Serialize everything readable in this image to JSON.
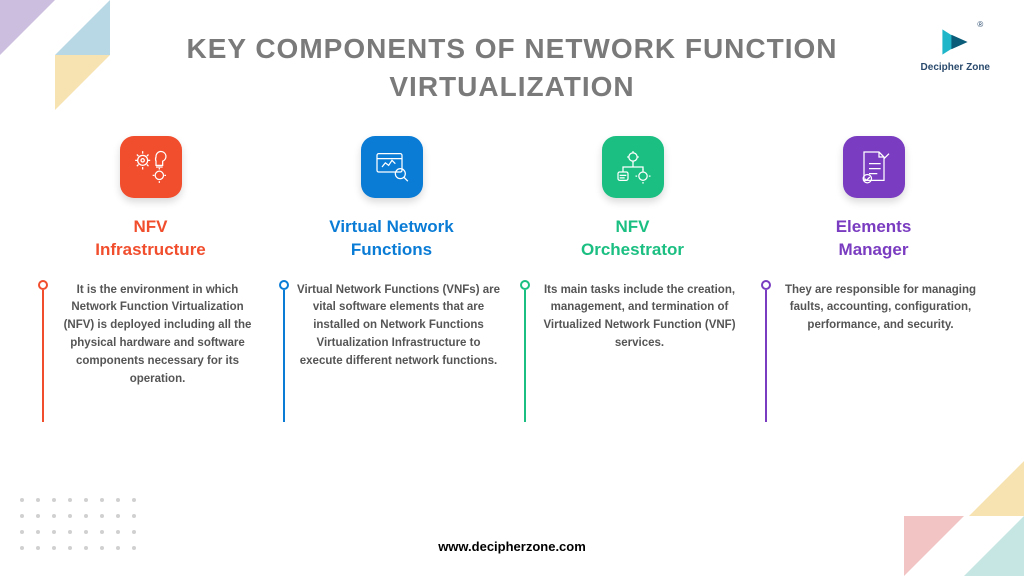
{
  "title_line1": "KEY COMPONENTS OF NETWORK FUNCTION",
  "title_line2": "VIRTUALIZATION",
  "brand": {
    "name": "Decipher Zone",
    "register": "®"
  },
  "footer": "www.decipherzone.com",
  "colors": {
    "c1": "#f14e2e",
    "c2": "#0a7cd6",
    "c3": "#1bbf82",
    "c4": "#7a3cc0"
  },
  "cards": [
    {
      "title_l1": "NFV",
      "title_l2": "Infrastructure",
      "icon": "gears-bulb-icon",
      "desc": "It is the environment in which Network Function Virtualization (NFV) is deployed including all the physical hardware and software components necessary for its operation."
    },
    {
      "title_l1": "Virtual Network",
      "title_l2": "Functions",
      "icon": "dashboard-search-icon",
      "desc": "Virtual Network Functions (VNFs) are vital software elements that are installed on Network Functions Virtualization Infrastructure to execute different network functions."
    },
    {
      "title_l1": "NFV",
      "title_l2": "Orchestrator",
      "icon": "process-icon",
      "desc": "Its main tasks include the creation, management, and termination of Virtualized Network Function (VNF) services."
    },
    {
      "title_l1": "Elements",
      "title_l2": "Manager",
      "icon": "document-check-icon",
      "desc": "They are responsible for managing faults, accounting, configuration, performance, and security."
    }
  ]
}
